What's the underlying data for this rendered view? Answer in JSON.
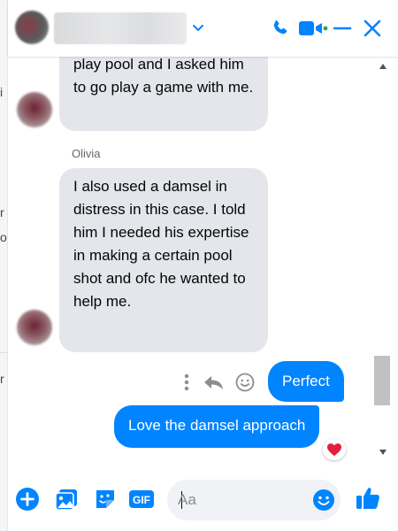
{
  "colors": {
    "accent": "#0084ff",
    "incoming_bubble": "#e4e6eb",
    "text": "#050505",
    "muted": "#65676b"
  },
  "background_fragments": [
    "i",
    "r",
    "o",
    "r"
  ],
  "header": {
    "contact_name": "",
    "icons": [
      "chevron-down-icon",
      "phone-icon",
      "video-call-icon",
      "minimize-icon",
      "close-icon"
    ]
  },
  "messages": {
    "incoming_1": "play pool and I asked him to go play a game with me.",
    "sender": "Olivia",
    "incoming_2": "I also used a damsel in distress in this case. I told him I needed his expertise in making a certain pool shot and ofc he wanted to help me.",
    "outgoing_1": "Perfect",
    "outgoing_2": "Love the damsel approach",
    "reaction": "heart"
  },
  "composer": {
    "placeholder": "Aa",
    "gif_label": "GIF",
    "icons": [
      "plus-icon",
      "photo-icon",
      "sticker-icon",
      "gif-icon",
      "emoji-icon",
      "thumbs-up-icon"
    ]
  }
}
